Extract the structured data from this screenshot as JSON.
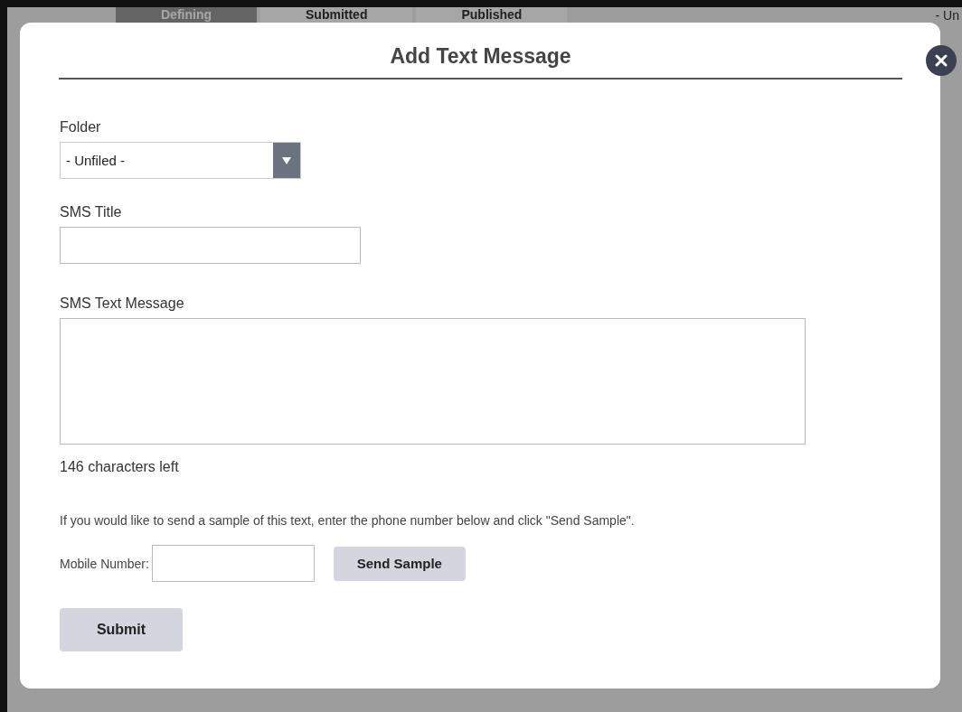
{
  "background": {
    "tabs": [
      {
        "label": "Defining",
        "selected": true
      },
      {
        "label": "Submitted",
        "selected": false
      },
      {
        "label": "Published",
        "selected": false
      }
    ],
    "filter_text": "- Un"
  },
  "dialog": {
    "title": "Add Text Message",
    "folder": {
      "label": "Folder",
      "value": "- Unfiled -"
    },
    "sms_title": {
      "label": "SMS Title"
    },
    "sms_text": {
      "label": "SMS Text Message"
    },
    "counter": "146 characters left",
    "instructions": "If you would like to send a sample of this text, enter the phone number below and click \"Send Sample\".",
    "mobile": {
      "label": "Mobile Number:"
    },
    "send_button": "Send Sample",
    "submit_button": "Submit"
  }
}
